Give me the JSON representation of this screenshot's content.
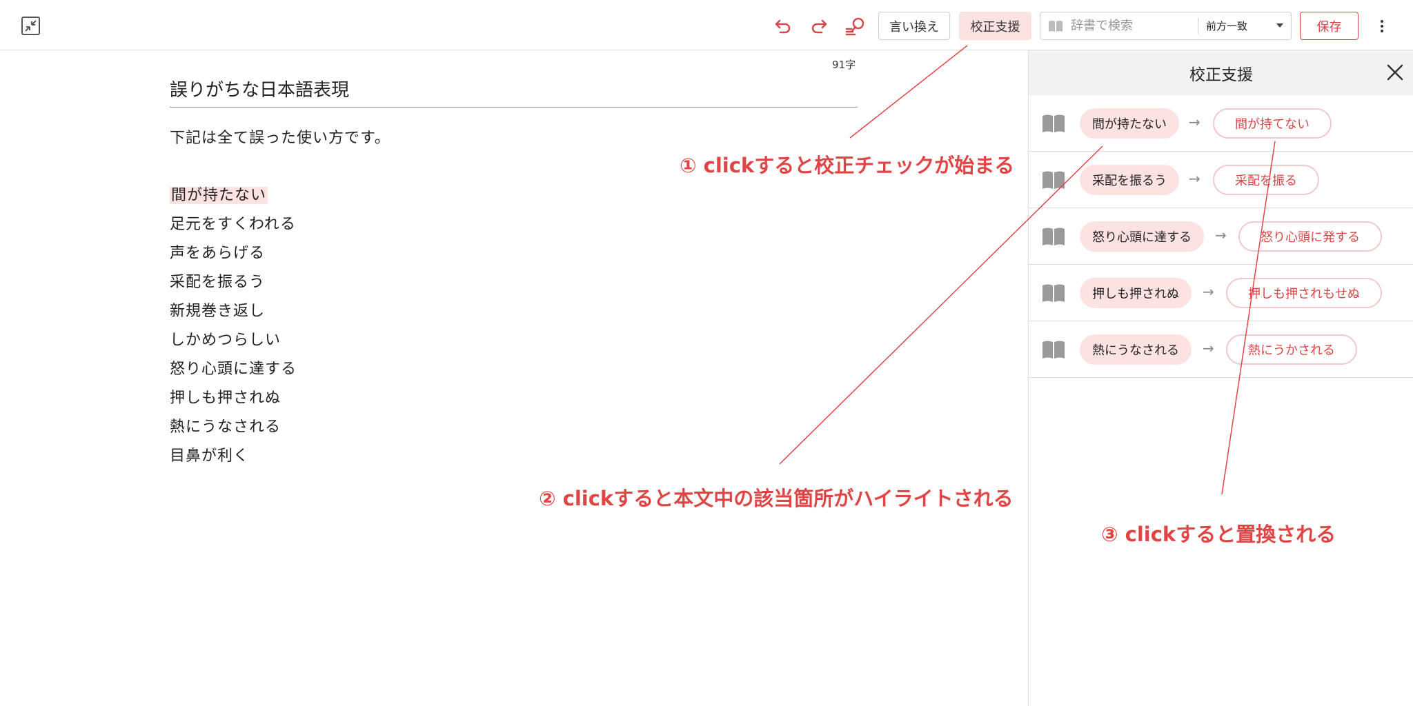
{
  "toolbar": {
    "rephrase_label": "言い換え",
    "proof_label": "校正支援",
    "dict_placeholder": "辞書で検索",
    "dict_mode": "前方一致",
    "save_label": "保存"
  },
  "editor": {
    "char_count": "91字",
    "title": "誤りがちな日本語表現",
    "intro": "下記は全て誤った使い方です。",
    "highlighted": "間が持たない",
    "lines": [
      "足元をすくわれる",
      "声をあらげる",
      "采配を振るう",
      "新規巻き返し",
      "しかめつらしい",
      "怒り心頭に達する",
      "押しも押されぬ",
      "熱にうなされる",
      "目鼻が利く"
    ]
  },
  "panel": {
    "title": "校正支援",
    "suggestions": [
      {
        "wrong": "間が持たない",
        "right": "間が持てない"
      },
      {
        "wrong": "采配を振るう",
        "right": "采配を振る"
      },
      {
        "wrong": "怒り心頭に達する",
        "right": "怒り心頭に発する"
      },
      {
        "wrong": "押しも押されぬ",
        "right": "押しも押されもせぬ"
      },
      {
        "wrong": "熱にうなされる",
        "right": "熱にうかされる"
      }
    ]
  },
  "annotations": {
    "a1": "① clickすると校正チェックが始まる",
    "a2": "② clickすると本文中の該当箇所がハイライトされる",
    "a3": "③ clickすると置換される"
  },
  "colors": {
    "accent": "#d84747",
    "highlight": "#fde2e2",
    "annotation": "#e04545"
  },
  "icons": [
    "collapse-icon",
    "undo-icon",
    "redo-icon",
    "search-list-icon",
    "book-icon",
    "dropdown-caret-icon",
    "kebab-icon",
    "close-icon",
    "arrow-icon"
  ]
}
